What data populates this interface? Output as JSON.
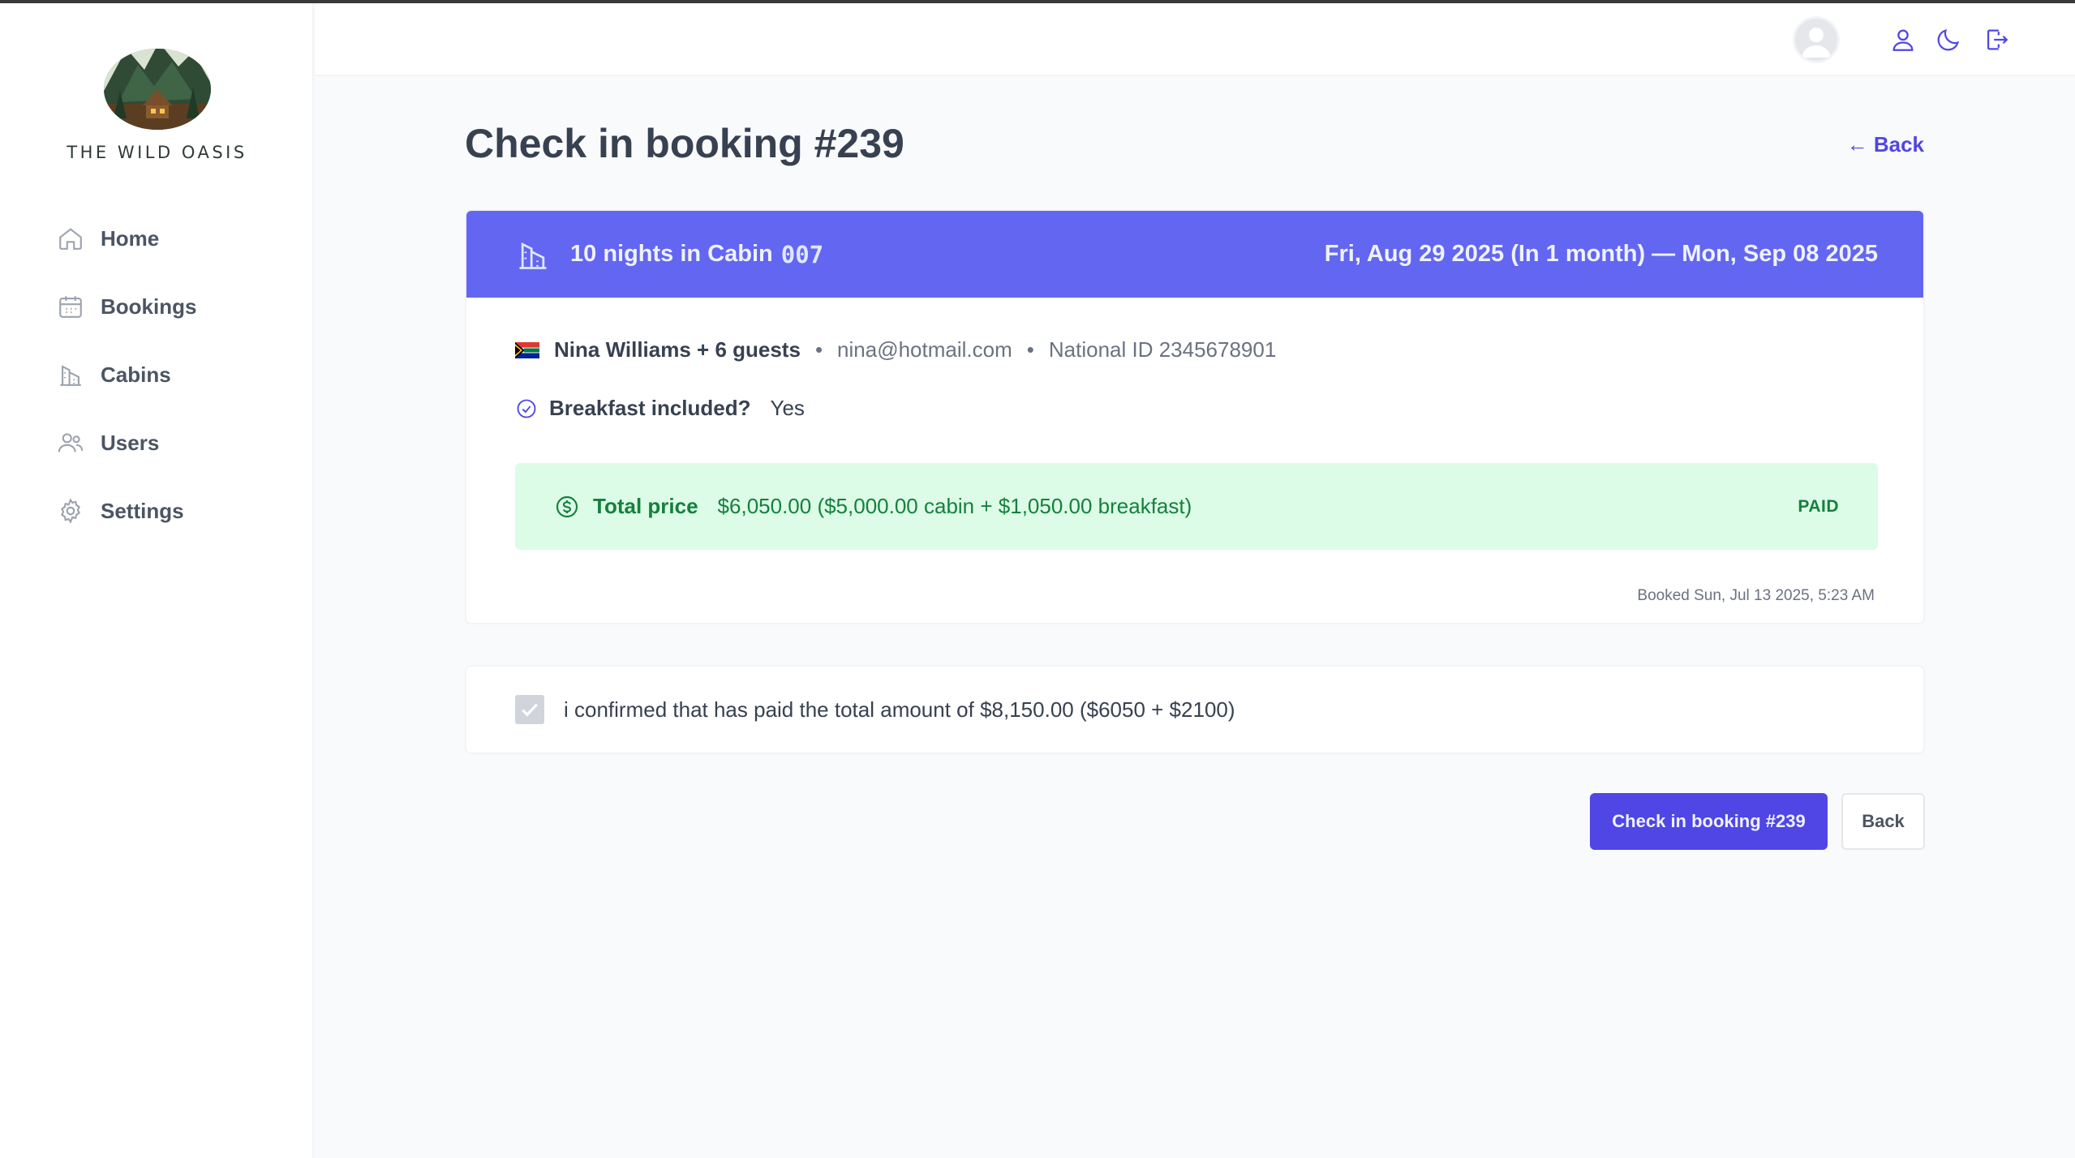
{
  "app": {
    "logo_text": "THE WILD OASIS"
  },
  "sidebar": {
    "items": [
      {
        "label": "Home",
        "icon": "home-icon"
      },
      {
        "label": "Bookings",
        "icon": "calendar-icon"
      },
      {
        "label": "Cabins",
        "icon": "buildings-icon"
      },
      {
        "label": "Users",
        "icon": "users-icon"
      },
      {
        "label": "Settings",
        "icon": "gear-icon"
      }
    ]
  },
  "header": {
    "icons": [
      "user-icon",
      "moon-icon",
      "logout-icon"
    ]
  },
  "page": {
    "title": "Check in booking #239",
    "back_link": "← Back"
  },
  "booking": {
    "nights_label": "10 nights in Cabin",
    "cabin_code": "007",
    "dates": "Fri, Aug 29 2025 (In 1 month) — Mon, Sep 08 2025",
    "guest_name": "Nina Williams + 6 guests",
    "separator": "•",
    "email": "nina@hotmail.com",
    "national_id": "National ID 2345678901",
    "breakfast_label": "Breakfast included?",
    "breakfast_value": "Yes",
    "price_label": "Total price",
    "price_value": "$6,050.00 ($5,000.00 cabin + $1,050.00 breakfast)",
    "status": "PAID",
    "booked_at": "Booked Sun, Jul 13 2025, 5:23 AM"
  },
  "confirm": {
    "text": "i confirmed that has paid the total amount of $8,150.00 ($6050 + $2100)",
    "checked": true
  },
  "actions": {
    "primary_label": "Check in booking #239",
    "secondary_label": "Back"
  },
  "colors": {
    "accent": "#4f46e5",
    "header_band": "#6366f1",
    "paid_bg": "#dcfce7",
    "paid_text": "#15803d"
  }
}
